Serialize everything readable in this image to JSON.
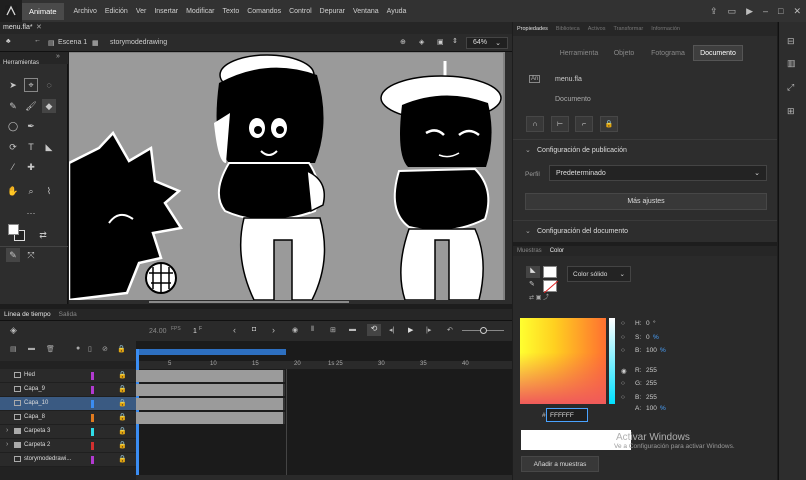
{
  "menubar": {
    "app_name": "Animate",
    "items": [
      "Archivo",
      "Edición",
      "Ver",
      "Insertar",
      "Modificar",
      "Texto",
      "Comandos",
      "Control",
      "Depurar",
      "Ventana",
      "Ayuda"
    ]
  },
  "document": {
    "tab_label": "menu.fla*"
  },
  "scene": {
    "scene_label": "Escena 1",
    "symbol_label": "storymodedrawing",
    "zoom": "64%"
  },
  "tools": {
    "title": "Herramientas"
  },
  "timeline": {
    "tab_timeline": "Línea de tiempo",
    "tab_output": "Salida",
    "fps": "24.00",
    "fps_unit": "FPS",
    "frame": "1",
    "frame_unit": "F",
    "ruler_marks": [
      "1s",
      "5",
      "10",
      "15",
      "20",
      "25",
      "30",
      "35",
      "40"
    ],
    "layers": [
      {
        "name": "Hed",
        "color": "#b23ad0",
        "type": "layer",
        "selected": false
      },
      {
        "name": "Capa_9",
        "color": "#b23ad0",
        "type": "layer",
        "selected": false
      },
      {
        "name": "Capa_10",
        "color": "#3b8df2",
        "type": "layer",
        "selected": true
      },
      {
        "name": "Capa_8",
        "color": "#e07a1f",
        "type": "layer",
        "selected": false
      },
      {
        "name": "Carpeta 3",
        "color": "#2fdde8",
        "type": "folder",
        "selected": false
      },
      {
        "name": "Carpeta 2",
        "color": "#d23030",
        "type": "folder",
        "selected": false
      },
      {
        "name": "storymodedrawi...",
        "color": "#b23ad0",
        "type": "layer",
        "selected": false
      }
    ]
  },
  "properties": {
    "tabs": [
      "Propiedades",
      "Biblioteca",
      "Activos",
      "Transformar",
      "Información"
    ],
    "segments": [
      "Herramienta",
      "Objeto",
      "Fotograma",
      "Documento"
    ],
    "active_segment": "Documento",
    "doc_name": "menu.fla",
    "doc_type": "Documento",
    "publish_section": "Configuración de publicación",
    "profile_label": "Perfil",
    "profile_value": "Predeterminado",
    "more_settings": "Más ajustes",
    "doc_settings_section": "Configuración del documento"
  },
  "color": {
    "tabs": [
      "Muestras",
      "Color"
    ],
    "active_tab": "Color",
    "fill_type": "Color sólido",
    "h_label": "H:",
    "h_value": "0",
    "h_unit": "°",
    "s_label": "S:",
    "s_value": "0",
    "s_unit": "%",
    "b_label": "B:",
    "b_value": "100",
    "b_unit": "%",
    "r_label": "R:",
    "r_value": "255",
    "g_label": "G:",
    "g_value": "255",
    "bb_label": "B:",
    "bb_value": "255",
    "a_label": "A:",
    "a_value": "100",
    "a_unit": "%",
    "hex_prefix": "#",
    "hex_value": "FFFFFF",
    "add_swatch": "Añadir a muestras"
  },
  "watermark": {
    "title": "Activar Windows",
    "subtitle": "Ve a Configuración para activar Windows."
  }
}
